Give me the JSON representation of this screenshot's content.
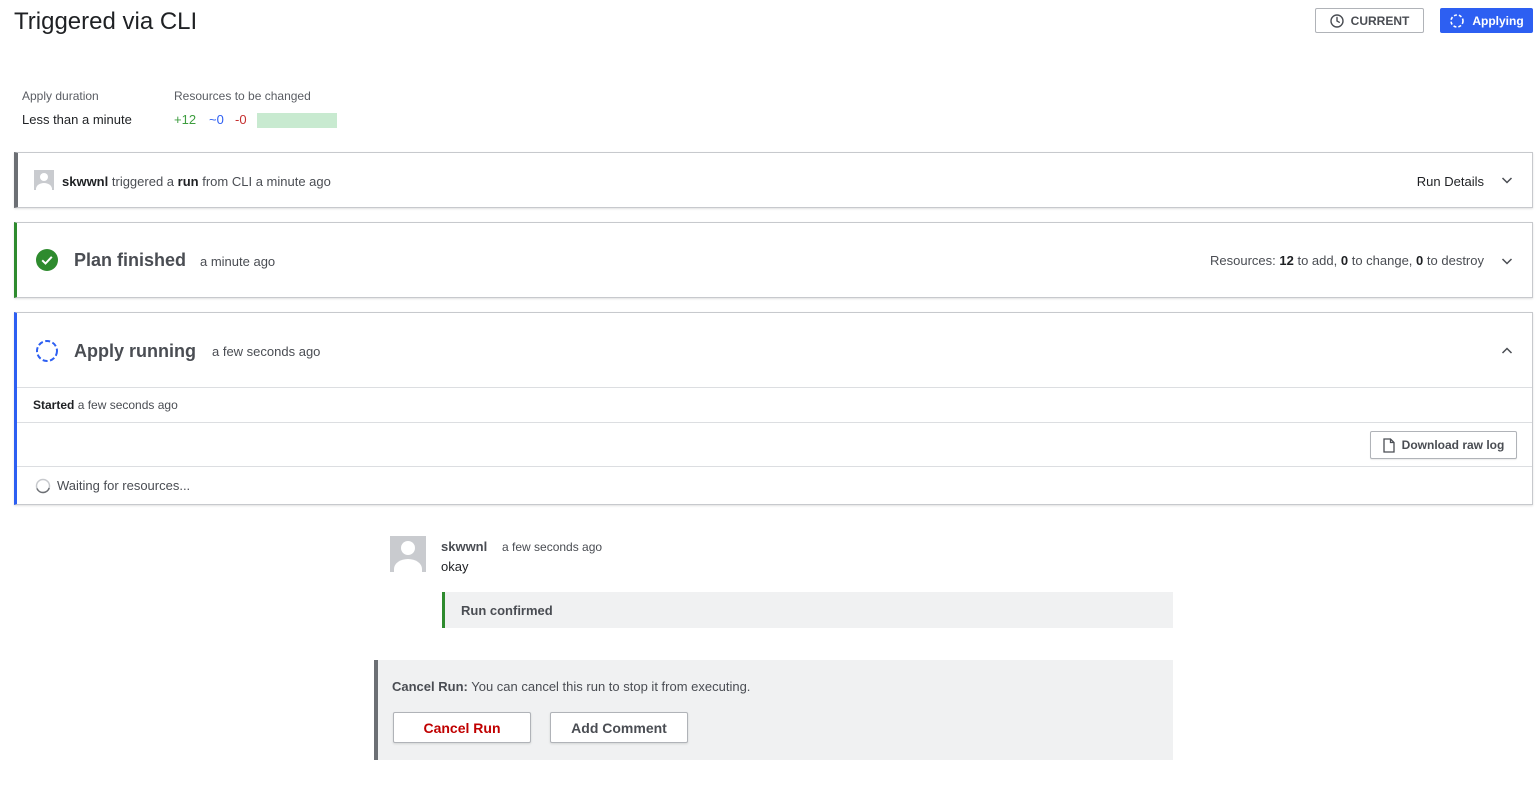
{
  "header": {
    "title": "Triggered via CLI",
    "current_label": "CURRENT",
    "applying_label": "Applying"
  },
  "stats": {
    "apply_duration_label": "Apply duration",
    "apply_duration_value": "Less than a minute",
    "resources_label": "Resources to be changed",
    "add": "+12",
    "change": "~0",
    "destroy": "-0"
  },
  "trigger": {
    "user": "skwwnl",
    "text1": "triggered a",
    "run": "run",
    "text2": "from CLI a minute ago",
    "run_details_label": "Run Details"
  },
  "plan": {
    "title": "Plan finished",
    "time": "a minute ago",
    "resources_prefix": "Resources:",
    "add_count": "12",
    "add_text": "to add,",
    "change_count": "0",
    "change_text": "to change,",
    "destroy_count": "0",
    "destroy_text": "to destroy"
  },
  "apply": {
    "title": "Apply running",
    "time": "a few seconds ago",
    "started_label": "Started",
    "started_time": "a few seconds ago",
    "download_label": "Download raw log",
    "waiting_text": "Waiting for resources..."
  },
  "comment": {
    "user": "skwwnl",
    "time": "a few seconds ago",
    "body": "okay",
    "confirmed": "Run confirmed"
  },
  "cancel": {
    "label": "Cancel Run:",
    "text": "You can cancel this run to stop it from executing.",
    "cancel_button": "Cancel Run",
    "comment_button": "Add Comment"
  },
  "colors": {
    "accent_blue": "#2d5ff2",
    "success_green": "#2e8b2e",
    "danger_red": "#c00000",
    "add_bar": "#c8ead0"
  }
}
